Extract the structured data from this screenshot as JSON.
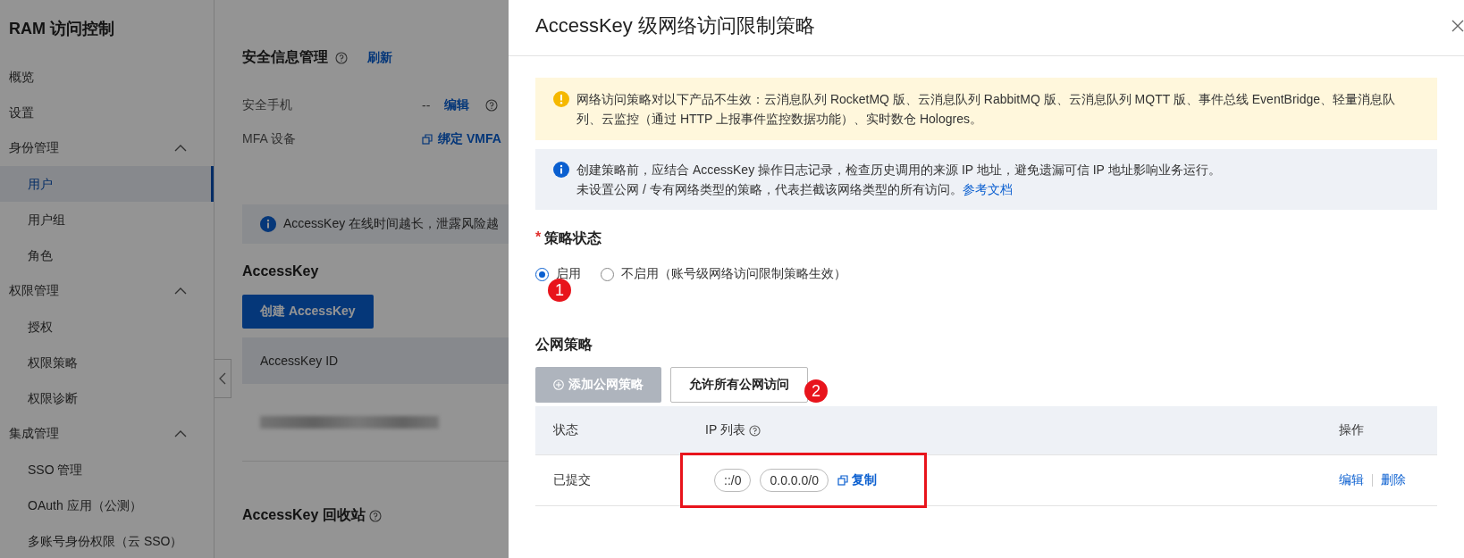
{
  "sidebar": {
    "title": "RAM 访问控制",
    "items": [
      {
        "label": "概览",
        "kind": "link",
        "selected": false
      },
      {
        "label": "设置",
        "kind": "link",
        "selected": false
      },
      {
        "label": "身份管理",
        "kind": "group",
        "expanded": true,
        "children": [
          {
            "label": "用户",
            "selected": true
          },
          {
            "label": "用户组",
            "selected": false
          },
          {
            "label": "角色",
            "selected": false
          }
        ]
      },
      {
        "label": "权限管理",
        "kind": "group",
        "expanded": true,
        "children": [
          {
            "label": "授权",
            "selected": false
          },
          {
            "label": "权限策略",
            "selected": false
          },
          {
            "label": "权限诊断",
            "selected": false
          }
        ]
      },
      {
        "label": "集成管理",
        "kind": "group",
        "expanded": true,
        "children": [
          {
            "label": "SSO 管理",
            "selected": false
          },
          {
            "label": "OAuth 应用（公测）",
            "selected": false
          },
          {
            "label": "多账号身份权限（云 SSO）",
            "selected": false
          }
        ]
      }
    ]
  },
  "main": {
    "security": {
      "title": "安全信息管理",
      "refresh": "刷新",
      "rows": [
        {
          "label": "安全手机",
          "value": "--",
          "action": "编辑",
          "kind": "edit"
        },
        {
          "label": "MFA 设备",
          "action": "绑定 VMFA",
          "kind": "bind"
        }
      ]
    },
    "notice": "AccessKey 在线时间越长，泄露风险越",
    "accesskey": {
      "title": "AccessKey",
      "create_button": "创建 AccessKey",
      "columns": [
        "AccessKey ID"
      ]
    },
    "recycle_title": "AccessKey 回收站"
  },
  "drawer": {
    "title": "AccessKey 级网络访问限制策略",
    "warning": "网络访问策略对以下产品不生效：云消息队列 RocketMQ 版、云消息队列 RabbitMQ 版、云消息队列 MQTT 版、事件总线 EventBridge、轻量消息队列、云监控（通过 HTTP 上报事件监控数据功能）、实时数仓 Hologres。",
    "info": {
      "line_1": "创建策略前，应结合 AccessKey 操作日志记录，检查历史调用的来源 IP 地址，避免遗漏可信 IP 地址影响业务运行。",
      "line_2": "未设置公网 / 专有网络类型的策略，代表拦截该网络类型的所有访问。",
      "link": "参考文档"
    },
    "status": {
      "label": "策略状态",
      "required": true,
      "required_mark": "*",
      "options": [
        {
          "label": "启用",
          "selected": true
        },
        {
          "label": "不启用（账号级网络访问限制策略生效）",
          "selected": false
        }
      ]
    },
    "public": {
      "title": "公网策略",
      "buttons": [
        {
          "label": "添加公网策略",
          "kind": "add",
          "disabled": true
        },
        {
          "label": "允许所有公网访问",
          "kind": "plain",
          "disabled": false
        }
      ],
      "columns": [
        "状态",
        "IP 列表",
        "操作"
      ],
      "rows": [
        {
          "status": "已提交",
          "ips": [
            "::/0",
            "0.0.0.0/0"
          ],
          "copy": "复制",
          "actions": [
            "编辑",
            "删除"
          ]
        }
      ]
    }
  },
  "annotations": [
    {
      "label": "1"
    },
    {
      "label": "2"
    }
  ]
}
